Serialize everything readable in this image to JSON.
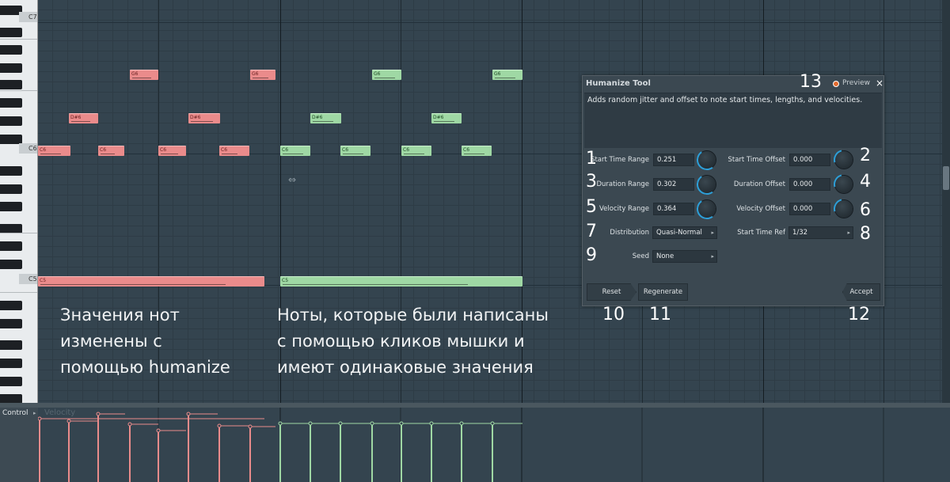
{
  "keyboard": {
    "octave_labels": [
      "C7",
      "C6",
      "C5"
    ]
  },
  "notes": {
    "red": [
      {
        "label": "G6"
      },
      {
        "label": "G6"
      },
      {
        "label": "D#6"
      },
      {
        "label": "D#6"
      },
      {
        "label": "C6"
      },
      {
        "label": "C6"
      },
      {
        "label": "C6"
      },
      {
        "label": "C6"
      },
      {
        "label": "C5"
      }
    ],
    "green": [
      {
        "label": "G6"
      },
      {
        "label": "G6"
      },
      {
        "label": "D#6"
      },
      {
        "label": "D#6"
      },
      {
        "label": "C6"
      },
      {
        "label": "C6"
      },
      {
        "label": "C6"
      },
      {
        "label": "C6"
      },
      {
        "label": "C5"
      }
    ]
  },
  "captions": {
    "left": [
      "Значения нот",
      "изменены с",
      "помощью humanize"
    ],
    "right": [
      "Ноты, которые были написаны",
      "с помощью кликов мышки и",
      "имеют одинаковые значения"
    ]
  },
  "numbers": {
    "n1": "1",
    "n2": "2",
    "n3": "3",
    "n4": "4",
    "n5": "5",
    "n6": "6",
    "n7": "7",
    "n8": "8",
    "n9": "9",
    "n10": "10",
    "n11": "11",
    "n12": "12",
    "n13": "13"
  },
  "dialog": {
    "title": "Humanize Tool",
    "preview_label": "Preview",
    "close_glyph": "×",
    "description": "Adds random jitter and offset to note start times, lengths, and velocities.",
    "fields": {
      "start_time_range": {
        "label": "Start Time Range",
        "value": "0.251"
      },
      "duration_range": {
        "label": "Duration Range",
        "value": "0.302"
      },
      "velocity_range": {
        "label": "Velocity Range",
        "value": "0.364"
      },
      "start_time_offset": {
        "label": "Start Time Offset",
        "value": "0.000"
      },
      "duration_offset": {
        "label": "Duration Offset",
        "value": "0.000"
      },
      "velocity_offset": {
        "label": "Velocity Offset",
        "value": "0.000"
      },
      "distribution": {
        "label": "Distribution",
        "value": "Quasi-Normal"
      },
      "start_time_ref": {
        "label": "Start Time Ref",
        "value": "1/32"
      },
      "seed": {
        "label": "Seed",
        "value": "None"
      }
    },
    "buttons": {
      "reset": "Reset",
      "regenerate": "Regenerate",
      "accept": "Accept"
    },
    "preview_color": "#e46a2d",
    "accent_color": "#2d9fd8"
  },
  "control": {
    "label": "Control",
    "parameter": "Velocity"
  },
  "colors": {
    "humanized_note": "#ea8b8b",
    "clicked_note": "#9fd8a4",
    "background": "#34444f"
  }
}
